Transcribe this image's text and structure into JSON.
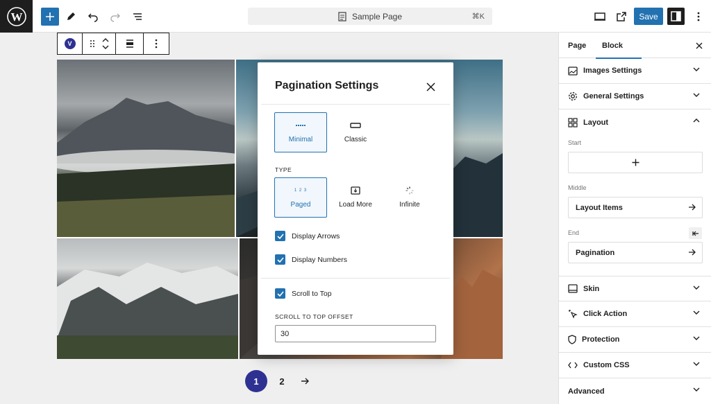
{
  "topbar": {
    "document_title": "Sample Page",
    "shortcut": "⌘K",
    "save_label": "Save",
    "icons": [
      "wordpress-logo",
      "plus",
      "pencil",
      "undo",
      "redo",
      "list-view",
      "document",
      "desktop-preview",
      "external-link",
      "sidebar-toggle",
      "more-vertical"
    ]
  },
  "block_toolbar": {
    "badge": "V",
    "icons": [
      "drag-handle",
      "chevron-up",
      "chevron-down",
      "align-center",
      "more-vertical"
    ]
  },
  "gallery": {
    "photos": [
      "mountain-fog",
      "coastal-peaks",
      "snowy-range",
      "sunset-cliffs"
    ]
  },
  "pagination": {
    "pages": [
      "1",
      "2"
    ],
    "current_page": "1"
  },
  "modal": {
    "title": "Pagination Settings",
    "styles": [
      {
        "label": "Minimal",
        "selected": true
      },
      {
        "label": "Classic",
        "selected": false
      }
    ],
    "type_label": "TYPE",
    "types": [
      {
        "label": "Paged",
        "icon_text": "1 2 3",
        "selected": true
      },
      {
        "label": "Load More",
        "selected": false
      },
      {
        "label": "Infinite",
        "selected": false
      }
    ],
    "checkboxes": [
      {
        "label": "Display Arrows",
        "checked": true
      },
      {
        "label": "Display Numbers",
        "checked": true
      },
      {
        "label": "Scroll to Top",
        "checked": true
      }
    ],
    "offset_label": "SCROLL TO TOP OFFSET",
    "offset_value": "30"
  },
  "sidebar": {
    "tabs": [
      "Page",
      "Block"
    ],
    "active_tab": "Block",
    "panels_top": [
      {
        "label": "Images Settings",
        "icon": "image"
      },
      {
        "label": "General Settings",
        "icon": "gear"
      },
      {
        "label": "Layout",
        "icon": "layout-grid",
        "expanded": true
      }
    ],
    "layout": {
      "start_label": "Start",
      "middle_label": "Middle",
      "middle_value": "Layout Items",
      "end_label": "End",
      "end_value": "Pagination"
    },
    "panels_bottom": [
      {
        "label": "Skin",
        "icon": "skin"
      },
      {
        "label": "Click Action",
        "icon": "pointer"
      },
      {
        "label": "Protection",
        "icon": "shield"
      },
      {
        "label": "Custom CSS",
        "icon": "code"
      },
      {
        "label": "Advanced",
        "icon": ""
      }
    ]
  },
  "colors": {
    "accent": "#2271b1",
    "brand_dark": "#2e3192",
    "dark": "#1e1e1e"
  }
}
